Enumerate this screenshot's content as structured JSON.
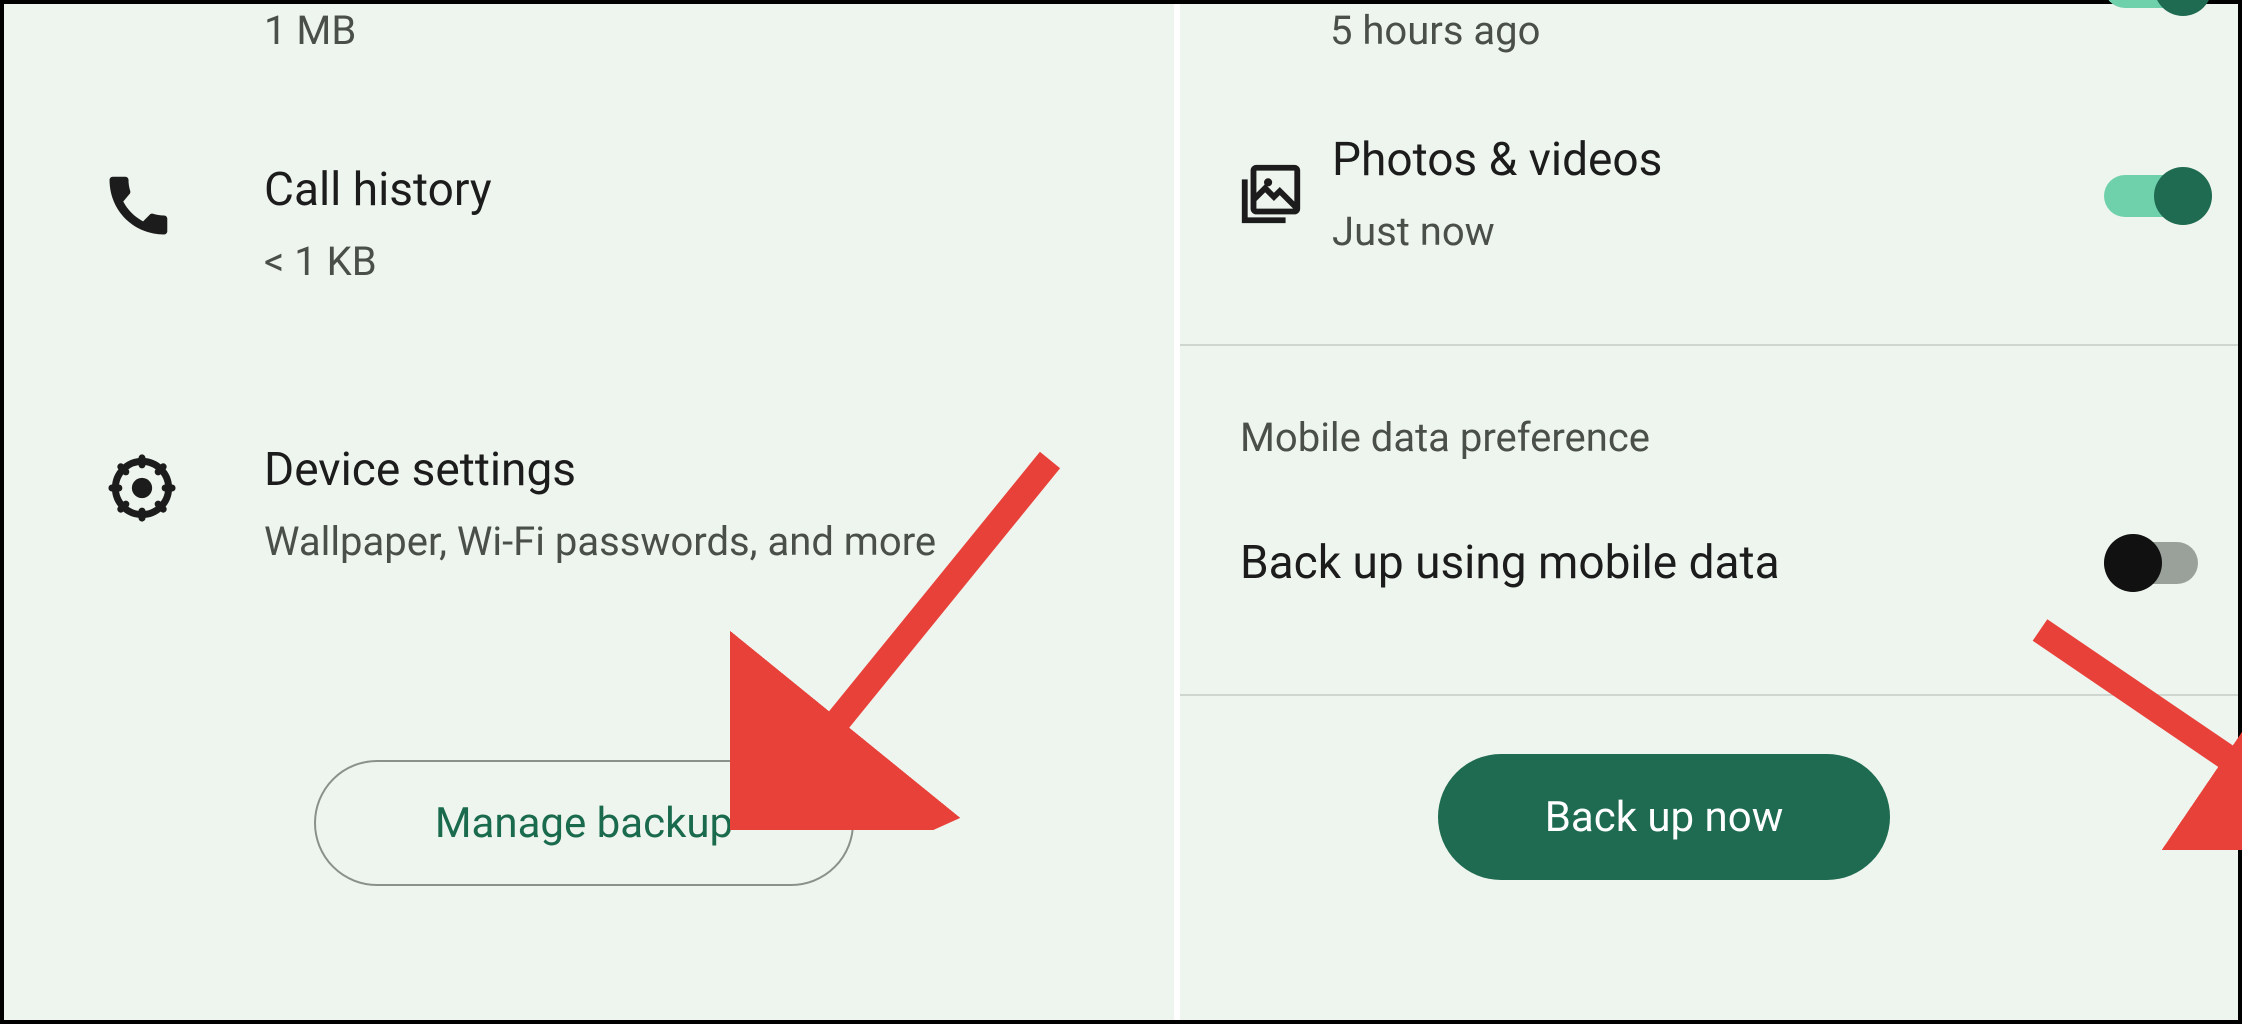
{
  "left": {
    "size_cut": "1 MB",
    "call_history": {
      "title": "Call history",
      "sub": "< 1 KB"
    },
    "device_settings": {
      "title": "Device settings",
      "sub": "Wallpaper, Wi-Fi passwords, and more"
    },
    "manage_backup_label": "Manage backup"
  },
  "right": {
    "time_cut": "5 hours ago",
    "photos": {
      "title": "Photos & videos",
      "sub": "Just now",
      "toggle": true
    },
    "section_label": "Mobile data preference",
    "mobile_data": {
      "title": "Back up using mobile data",
      "toggle": false
    },
    "backup_now_label": "Back up now"
  },
  "colors": {
    "bg": "#eef5ee",
    "accent": "#1f6b52",
    "accent_light": "#6fd1ac",
    "annotation": "#e8413a"
  }
}
